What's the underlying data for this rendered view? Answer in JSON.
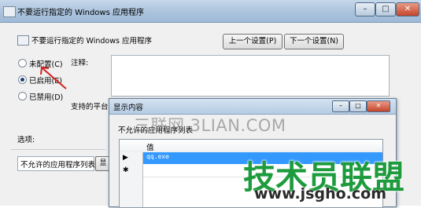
{
  "window": {
    "title": "不要运行指定的 Windows 应用程序",
    "buttons": {
      "minimize": "–",
      "maximize": "□",
      "close": "✕"
    }
  },
  "header": {
    "title": "不要运行指定的 Windows 应用程序",
    "prev_button": "上一个设置(P)",
    "next_button": "下一个设置(N)"
  },
  "options": {
    "not_configured": "未配置(C)",
    "enabled": "已启用(E)",
    "disabled": "已禁用(D)",
    "selected": "enabled"
  },
  "labels": {
    "comment": "注释:",
    "supported": "支持的平台:",
    "options": "选项:"
  },
  "list_field": {
    "label": "不允许的应用程序列表",
    "button": "显示..."
  },
  "dialog": {
    "title": "显示内容",
    "list_label": "不允许的应用程序列表",
    "column_header": "值",
    "rows": [
      "qq.exe"
    ],
    "row_markers": [
      "▶",
      "✱"
    ],
    "buttons": {
      "minimize": "–",
      "maximize": "□",
      "close": "✕"
    }
  },
  "watermarks": {
    "site": "三联网 3LIAN.COM",
    "brand": "技术员联盟",
    "url": "www.jsgho.com"
  },
  "colors": {
    "selection": "#3399ff",
    "brand_green": "#1d9b3d",
    "arrow_red": "#d42020"
  }
}
